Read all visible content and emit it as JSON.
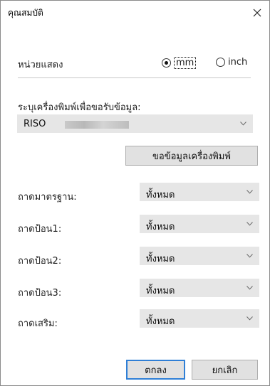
{
  "window": {
    "title": "คุณสมบัติ"
  },
  "units": {
    "label": "หน่วยแสดง",
    "options": [
      {
        "label": "mm",
        "selected": true
      },
      {
        "label": "inch",
        "selected": false
      }
    ]
  },
  "printer": {
    "label": "ระบุเครื่องพิมพ์เพื่อขอรับข้อมูล:",
    "selected": "RISO",
    "get_info_button": "ขอข้อมูลเครื่องพิมพ์"
  },
  "trays": [
    {
      "label": "ถาดมาตรฐาน:",
      "value": "ทั้งหมด"
    },
    {
      "label": "ถาดป้อน1:",
      "value": "ทั้งหมด"
    },
    {
      "label": "ถาดป้อน2:",
      "value": "ทั้งหมด"
    },
    {
      "label": "ถาดป้อน3:",
      "value": "ทั้งหมด"
    },
    {
      "label": "ถาดเสริม:",
      "value": "ทั้งหมด"
    }
  ],
  "buttons": {
    "ok": "ตกลง",
    "cancel": "ยกเลิก"
  },
  "colors": {
    "accent": "#2f7fd6",
    "control_bg": "#e6e6e6"
  },
  "icons": {
    "close": "close-icon",
    "dropdown": "chevron-down-icon"
  }
}
